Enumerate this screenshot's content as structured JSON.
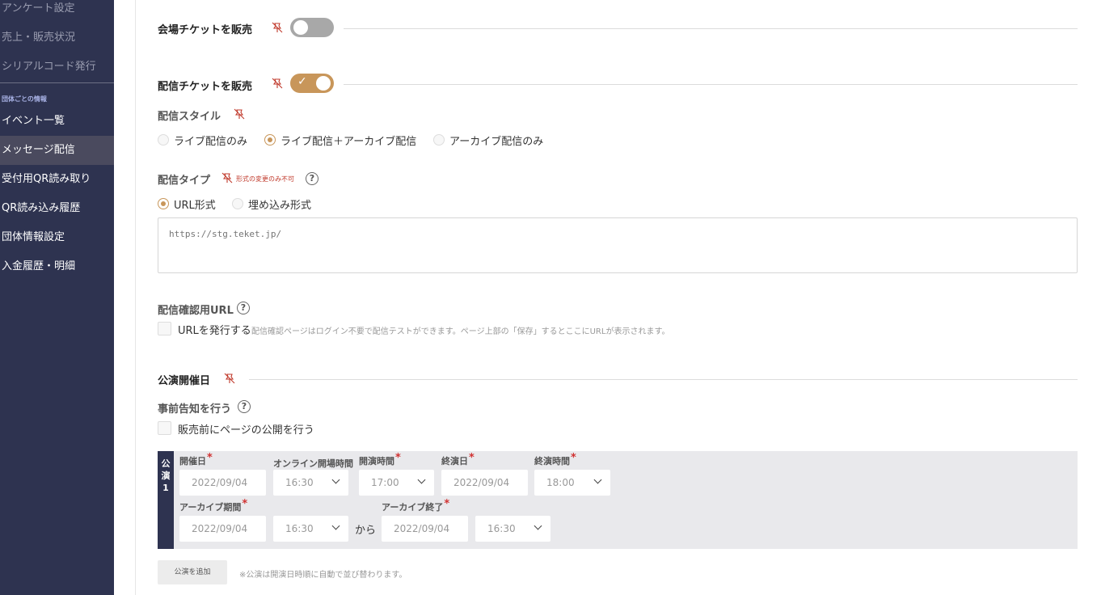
{
  "sidebar": {
    "items_top": [
      {
        "label": "アンケート設定"
      },
      {
        "label": "売上・販売状況"
      },
      {
        "label": "シリアルコード発行"
      }
    ],
    "section_heading": "団体ごとの情報",
    "items": [
      {
        "label": "イベント一覧"
      },
      {
        "label": "メッセージ配信"
      },
      {
        "label": "受付用QR読み取り"
      },
      {
        "label": "QR読み込み履歴"
      },
      {
        "label": "団体情報設定"
      },
      {
        "label": "入金履歴・明細"
      }
    ]
  },
  "venue_ticket": {
    "label": "会場チケットを販売",
    "enabled": false
  },
  "stream_ticket": {
    "label": "配信チケットを販売",
    "enabled": true
  },
  "stream_style": {
    "label": "配信スタイル",
    "options": [
      "ライブ配信のみ",
      "ライブ配信＋アーカイブ配信",
      "アーカイブ配信のみ"
    ],
    "selected": 1
  },
  "stream_type": {
    "label": "配信タイプ",
    "note": "形式の変更のみ不可",
    "help": "?",
    "options": [
      "URL形式",
      "埋め込み形式"
    ],
    "selected": 0,
    "url_placeholder": "https://stg.teket.jp/"
  },
  "confirm_url": {
    "label": "配信確認用URL",
    "help": "?",
    "checkbox_label": "URLを発行する",
    "note": "配信確認ページはログイン不要で配信テストができます。ページ上部の「保存」するとここにURLが表示されます。"
  },
  "performance_date": {
    "label": "公演開催日",
    "pre_notice_label": "事前告知を行う",
    "help": "?",
    "pre_notice_checkbox": "販売前にページの公開を行う"
  },
  "performance": {
    "tag": [
      "公",
      "演",
      "1"
    ],
    "fields": {
      "date_label": "開催日",
      "date_value": "2022/09/04",
      "online_open_label": "オンライン開場時間",
      "online_open_value": "16:30",
      "start_label": "開演時間",
      "start_value": "17:00",
      "end_date_label": "終演日",
      "end_date_value": "2022/09/04",
      "end_time_label": "終演時間",
      "end_time_value": "18:00",
      "archive_label": "アーカイブ期間",
      "archive_date_value": "2022/09/04",
      "archive_time_value": "16:30",
      "from_label": "から",
      "archive_end_label": "アーカイブ終了",
      "archive_end_date_value": "2022/09/04",
      "archive_end_time_value": "16:30",
      "required_mark": "*"
    }
  },
  "add_performance": {
    "button_label": "公演を追加",
    "note": "※公演は開演日時順に自動で並び替わります。"
  },
  "colors": {
    "sidebar_bg": "#2e3350",
    "accent": "#c8965a",
    "required": "#d13232"
  }
}
